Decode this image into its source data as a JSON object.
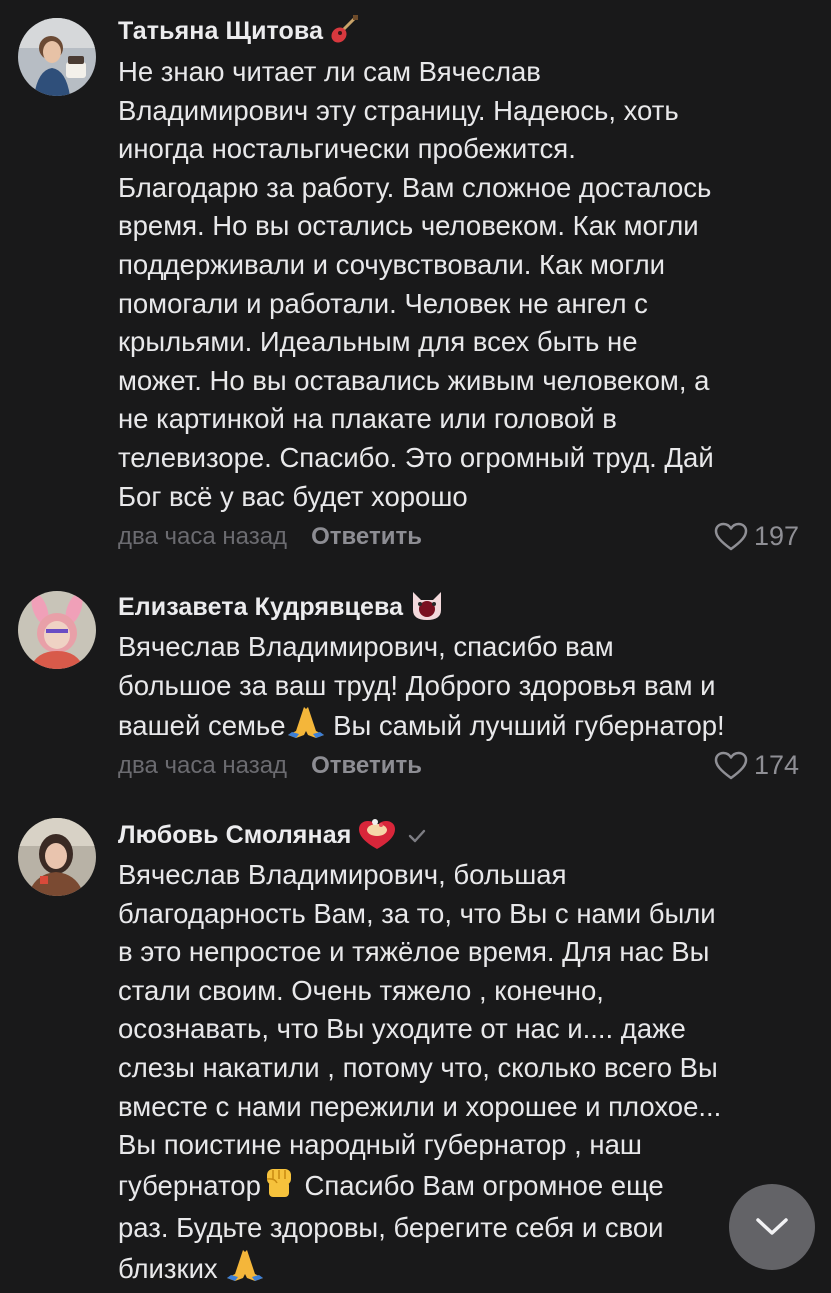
{
  "comments": [
    {
      "author": "Татьяна Щитова",
      "lines": [
        "Не знаю читает ли сам Вячеслав",
        "Владимирович эту страницу. Надеюсь, хоть",
        "иногда ностальгически пробежится.",
        "Благодарю за работу. Вам сложное досталось",
        "время. Но вы остались человеком. Как могли",
        "поддерживали и сочувствовали. Как могли",
        "помогали и работали. Человек не ангел с",
        "крыльями. Идеальным для всех быть не",
        "может. Но вы оставались живым человеком, а",
        "не картинкой на плакате или головой в",
        "телевизоре. Спасибо. Это огромный труд. Дай",
        "Бог всё у вас будет хорошо"
      ],
      "time": "два часа назад",
      "reply": "Ответить",
      "likes": "197",
      "author_emoji": "guitar-icon"
    },
    {
      "author": "Елизавета Кудрявцева",
      "lines": [
        "Вячеслав Владимирович, спасибо вам",
        "большое за ваш труд! Доброго здоровья вам и"
      ],
      "line3_a": "вашей семье",
      "line3_b": " Вы самый лучший губернатор!",
      "time": "два часа назад",
      "reply": "Ответить",
      "likes": "174",
      "author_emoji": "cat-face-icon"
    },
    {
      "author": "Любовь Смоляная",
      "lines": [
        "Вячеслав Владимирович, большая",
        "благодарность Вам, за то, что Вы с нами были",
        "в это непростое и тяжёлое время. Для нас Вы",
        "стали своим. Очень тяжело , конечно,",
        "осознавать, что Вы уходите от нас и.... даже",
        "слезы накатили , потому что, сколько всего Вы",
        "вместе с нами пережили и хорошее и плохое...",
        "Вы поистине народный губернатор , наш"
      ],
      "line9_a": "губернатор",
      "line9_b": " Спасибо Вам огромное еще",
      "line10": "раз. Будьте здоровы, берегите себя и свои",
      "line11": "близких ",
      "author_emoji": "heart-cake-icon",
      "verified": true
    }
  ],
  "colors": {
    "background": "#19191a",
    "text": "#e8e8ea",
    "meta": "#6b6b70",
    "reply": "#8d8d93"
  }
}
